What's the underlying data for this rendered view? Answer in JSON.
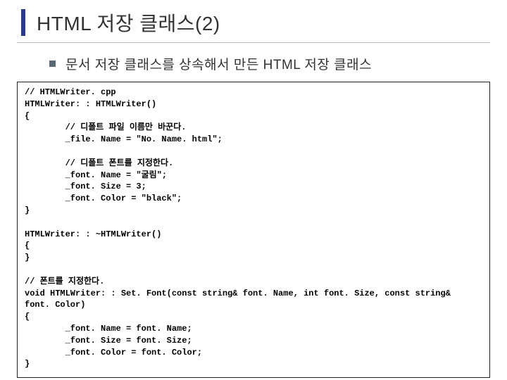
{
  "title": "HTML 저장 클래스(2)",
  "bullet": "문서 저장 클래스를 상속해서 만든 HTML 저장 클래스",
  "code": {
    "l1": "// HTMLWriter. cpp",
    "l2": "HTMLWriter: : HTMLWriter()",
    "l3": "{",
    "l4": "        // 디폴트 파일 이름만 바꾼다.",
    "l5": "        _file. Name = \"No. Name. html\";",
    "l6": "",
    "l7": "        // 디폴트 폰트를 지정한다.",
    "l8": "        _font. Name = \"굴림\";",
    "l9": "        _font. Size = 3;",
    "l10": "        _font. Color = \"black\";",
    "l11": "}",
    "l12": "",
    "l13": "HTMLWriter: : ~HTMLWriter()",
    "l14": "{",
    "l15": "}",
    "l16": "",
    "l17": "// 폰트를 지정한다.",
    "l18": "void HTMLWriter: : Set. Font(const string& font. Name, int font. Size, const string&",
    "l19": "font. Color)",
    "l20": "{",
    "l21": "        _font. Name = font. Name;",
    "l22": "        _font. Size = font. Size;",
    "l23": "        _font. Color = font. Color;",
    "l24": "}"
  }
}
